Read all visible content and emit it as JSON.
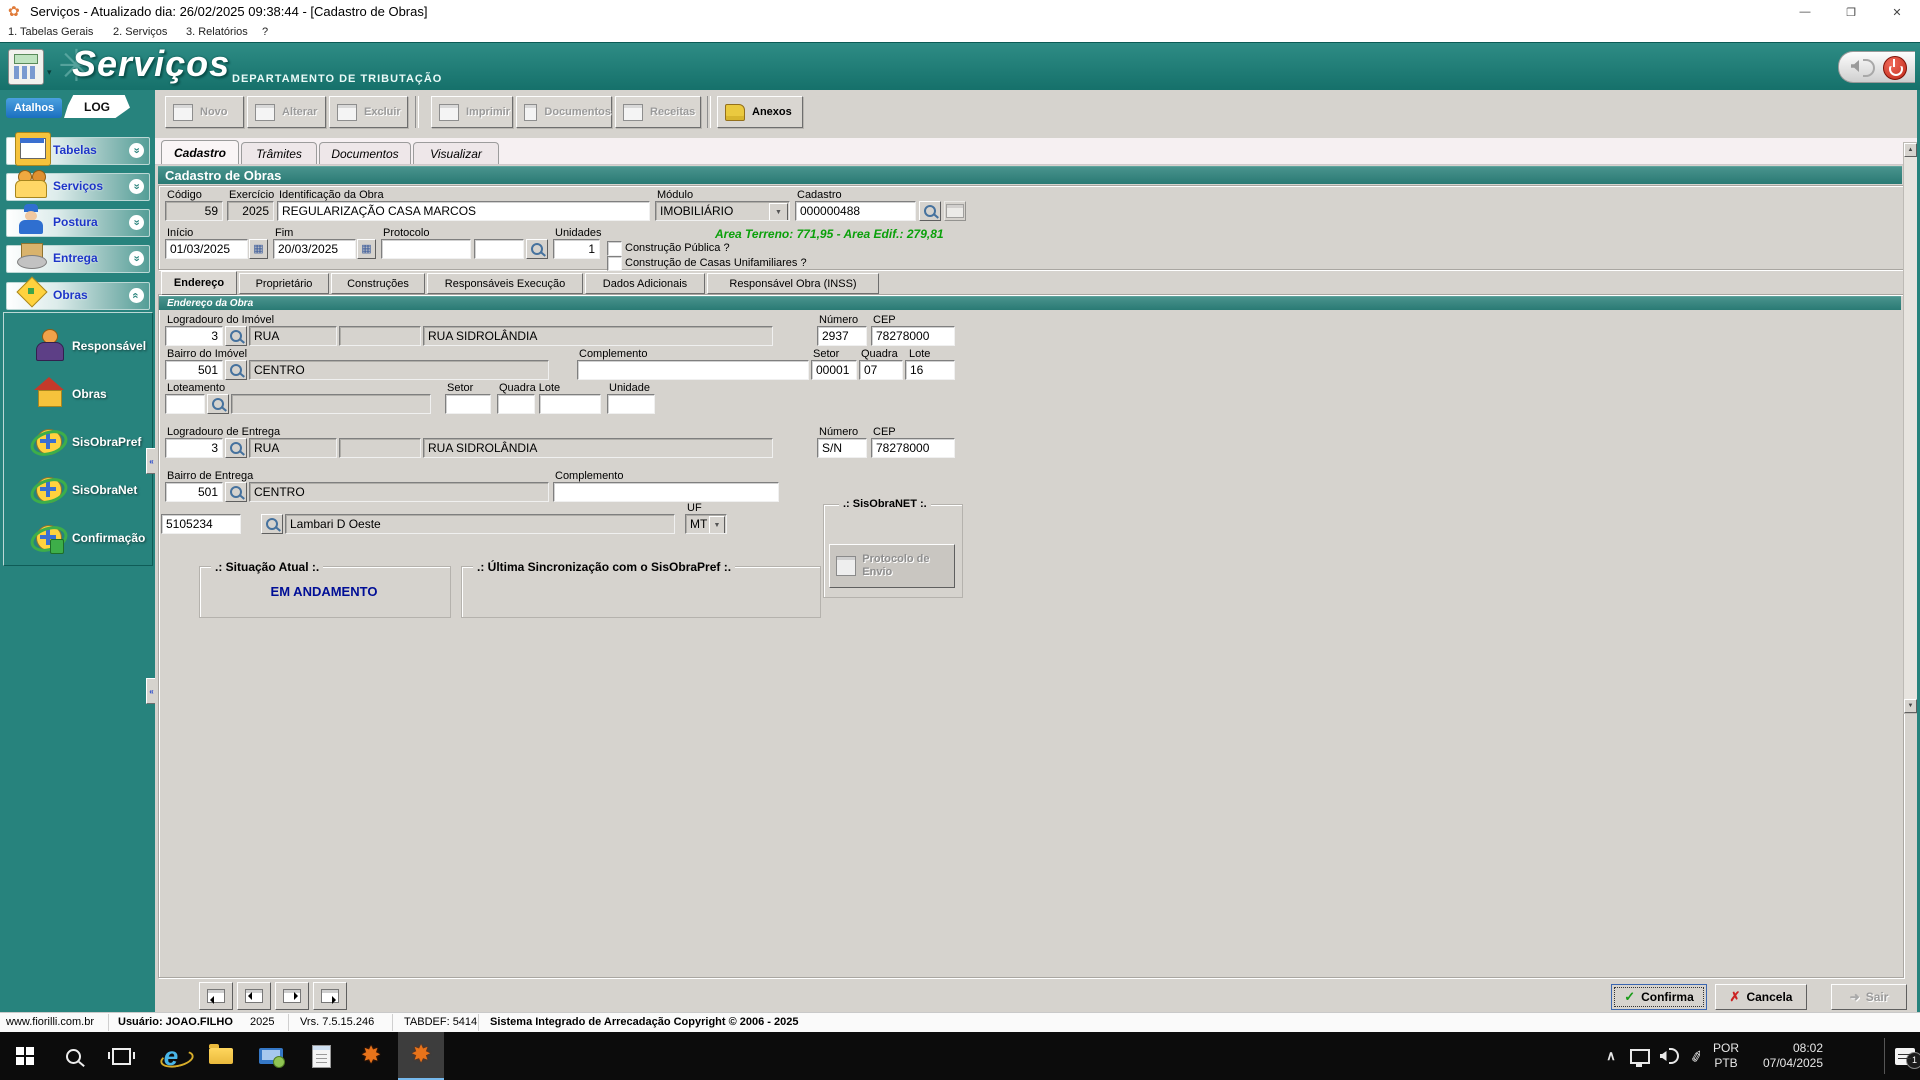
{
  "window": {
    "title": "Serviços - Atualizado dia: 26/02/2025 09:38:44 - [Cadastro de Obras]"
  },
  "glyphs": {
    "flower": "✿",
    "min": "—",
    "max": "❐",
    "close": "✕",
    "tri_down": "▼",
    "calendar": "▦",
    "chevrons": "»",
    "check": "✓",
    "cross": "✗",
    "star": "✸",
    "pen": "✎",
    "caret": "∧",
    "ie": "e",
    "scroll_up": "▲",
    "scroll_down": "▼",
    "splitter": "«",
    "banner_caret": "▾",
    "exit_arrow": "➜"
  },
  "menubar": {
    "items": [
      {
        "label": "1. Tabelas Gerais"
      },
      {
        "label": "2. Serviços"
      },
      {
        "label": "3. Relatórios"
      },
      {
        "label": "?"
      }
    ]
  },
  "banner": {
    "logo": "Serviços",
    "subtitle": "DEPARTAMENTO DE TRIBUTAÇÃO"
  },
  "sidebar": {
    "atalhos": "Atalhos",
    "log": "LOG",
    "sections": [
      {
        "label": "Tabelas"
      },
      {
        "label": "Serviços"
      },
      {
        "label": "Postura"
      },
      {
        "label": "Entrega"
      },
      {
        "label": "Obras"
      }
    ],
    "obras_items": [
      {
        "label": "Responsável"
      },
      {
        "label": "Obras"
      },
      {
        "label": "SisObraPref"
      },
      {
        "label": "SisObraNet"
      },
      {
        "label": "Confirmação"
      }
    ]
  },
  "toolbar": {
    "buttons": [
      {
        "label": "Novo"
      },
      {
        "label": "Alterar"
      },
      {
        "label": "Excluir"
      },
      {
        "label": "Imprimir"
      },
      {
        "label": "Documentos"
      },
      {
        "label": "Receitas"
      },
      {
        "label": "Anexos"
      }
    ]
  },
  "tabs": {
    "items": [
      {
        "label": "Cadastro"
      },
      {
        "label": "Trâmites"
      },
      {
        "label": "Documentos"
      },
      {
        "label": "Visualizar"
      }
    ]
  },
  "section_title": "Cadastro de Obras",
  "form": {
    "codigo_label": "Código",
    "codigo": "59",
    "exercicio_label": "Exercício",
    "exercicio": "2025",
    "identificacao_label": "Identificação da Obra",
    "identificacao": "REGULARIZAÇÃO CASA MARCOS",
    "modulo_label": "Módulo",
    "modulo": "IMOBILIÁRIO",
    "cadastro_label": "Cadastro",
    "cadastro": "000000488",
    "inicio_label": "Início",
    "inicio": "01/03/2025",
    "fim_label": "Fim",
    "fim": "20/03/2025",
    "protocolo_label": "Protocolo",
    "protocolo": "",
    "unidades_label": "Unidades",
    "unidades": "1",
    "areas": "Area Terreno: 771,95 - Area Edif.: 279,81",
    "check1": "Construção Pública ?",
    "check2": "Construção de Casas Unifamiliares ?"
  },
  "subtabs": {
    "items": [
      {
        "label": "Endereço"
      },
      {
        "label": "Proprietário"
      },
      {
        "label": "Construções"
      },
      {
        "label": "Responsáveis Execução"
      },
      {
        "label": "Dados Adicionais"
      },
      {
        "label": "Responsável Obra (INSS)"
      }
    ]
  },
  "address": {
    "header": "Endereço da Obra",
    "logradouro_imovel_label": "Logradouro do Imóvel",
    "numero_label": "Número",
    "cep_label": "CEP",
    "li_codigo": "3",
    "li_tipo": "RUA",
    "li_nome": "RUA SIDROLÂNDIA",
    "li_numero": "2937",
    "li_cep": "78278000",
    "bairro_imovel_label": "Bairro do Imóvel",
    "complemento_label": "Complemento",
    "setor_label": "Setor",
    "quadra_label": "Quadra",
    "lote_label": "Lote",
    "bi_codigo": "501",
    "bi_nome": "CENTRO",
    "bi_setor": "00001",
    "bi_quadra": "07",
    "bi_lote": "16",
    "loteamento_label": "Loteamento",
    "quadra_lote_label": "Quadra Lote",
    "unidade_label": "Unidade",
    "logradouro_entrega_label": "Logradouro de Entrega",
    "le_codigo": "3",
    "le_tipo": "RUA",
    "le_nome": "RUA SIDROLÂNDIA",
    "le_numero": "S/N",
    "le_cep": "78278000",
    "bairro_entrega_label": "Bairro de Entrega",
    "be_codigo": "501",
    "be_nome": "CENTRO",
    "cidade_codigo": "5105234",
    "cidade_nome": "Lambari D Oeste",
    "uf_label": "UF",
    "uf": "MT"
  },
  "groups": {
    "situacao_title": ".: Situação Atual :.",
    "situacao_value": "EM ANDAMENTO",
    "sinc_title": ".: Última Sincronização com o SisObraPref :.",
    "sisobranet_title": ".: SisObraNET :.",
    "protocolo_envio": "Protocolo de Envio"
  },
  "footer": {
    "confirma": "Confirma",
    "cancela": "Cancela",
    "sair": "Sair"
  },
  "statusbar": {
    "site": "www.fiorilli.com.br",
    "usuario": "Usuário: JOAO.FILHO",
    "ano": "2025",
    "versao": "Vrs. 7.5.15.246",
    "tabdef": "TABDEF: 5414",
    "sistema": "Sistema Integrado de Arrecadação Copyright © 2006 - 2025"
  },
  "taskbar": {
    "lang1": "POR",
    "lang2": "PTB",
    "time": "08:02",
    "date": "07/04/2025",
    "badge": "1"
  }
}
